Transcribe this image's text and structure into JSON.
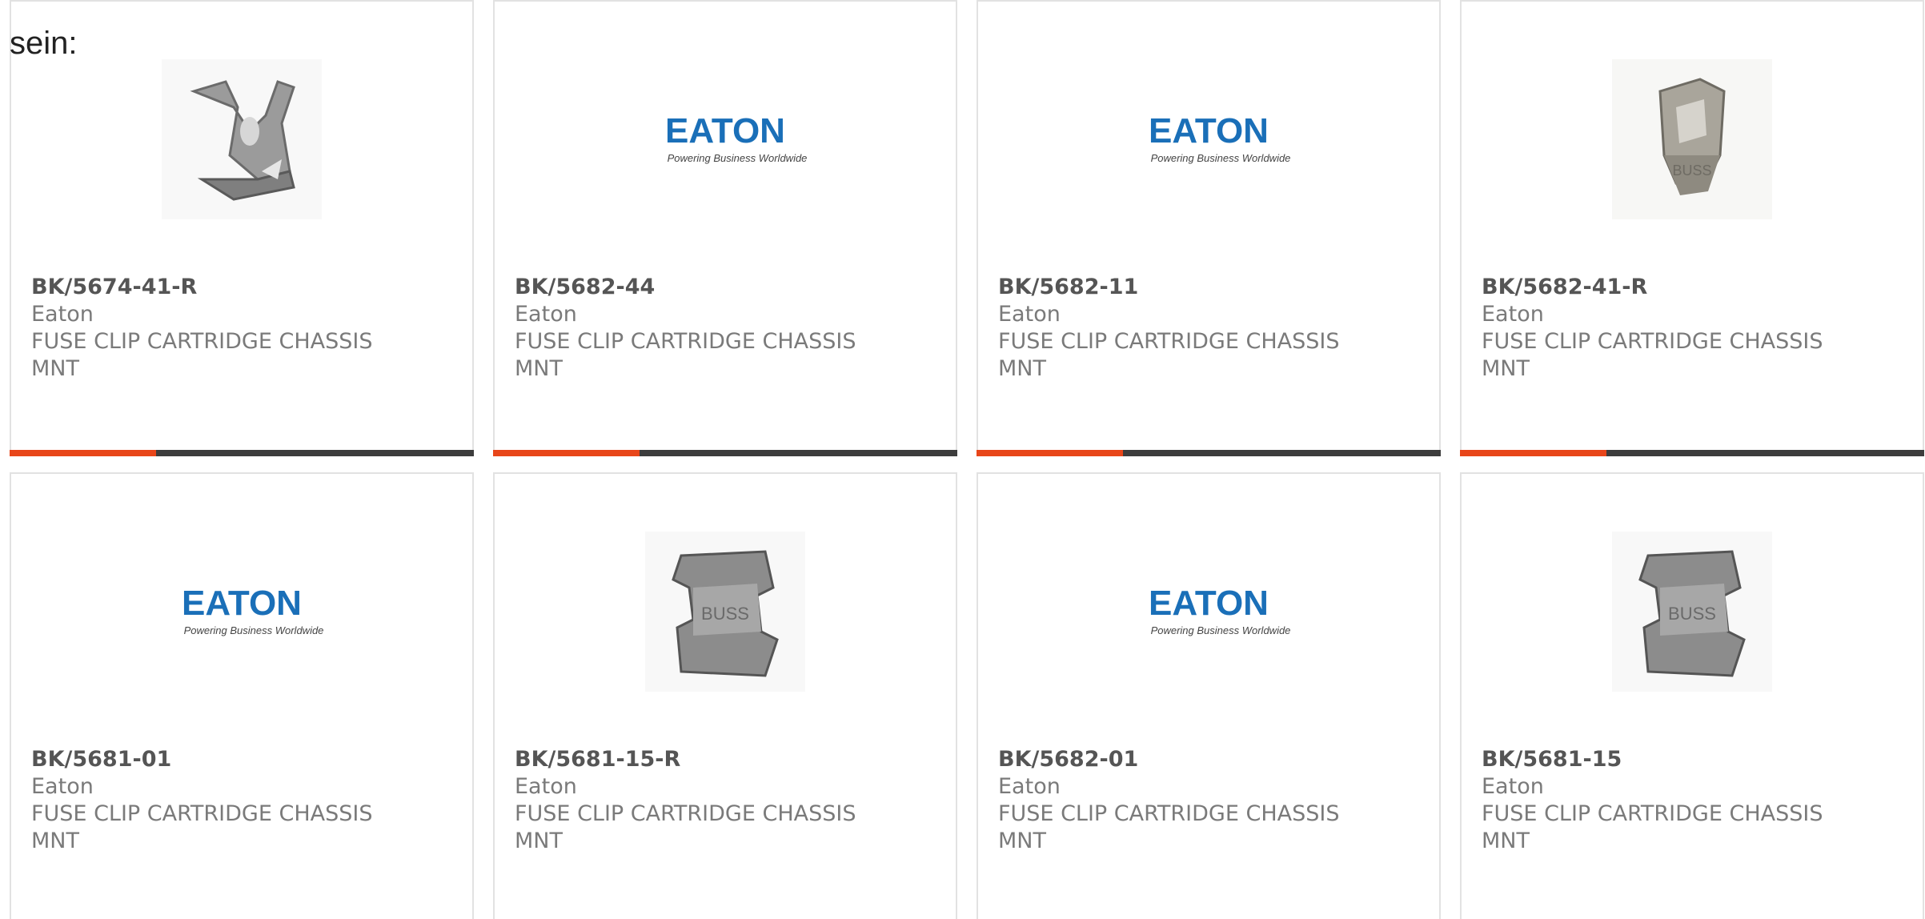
{
  "intro_text": "sein:",
  "colors": {
    "accent": "#e8461a",
    "bar": "#3d3d3d",
    "eaton_blue": "#1a6fb8",
    "border": "#e2e2e2"
  },
  "products": [
    {
      "part": "BK/5674-41-R",
      "maker": "Eaton",
      "desc": "FUSE CLIP CARTRIDGE CHASSIS MNT",
      "image": "fuse-clip-open"
    },
    {
      "part": "BK/5682-44",
      "maker": "Eaton",
      "desc": "FUSE CLIP CARTRIDGE CHASSIS MNT",
      "image": "eaton-logo"
    },
    {
      "part": "BK/5682-11",
      "maker": "Eaton",
      "desc": "FUSE CLIP CARTRIDGE CHASSIS MNT",
      "image": "eaton-logo"
    },
    {
      "part": "BK/5682-41-R",
      "maker": "Eaton",
      "desc": "FUSE CLIP CARTRIDGE CHASSIS MNT",
      "image": "fuse-clip-open"
    },
    {
      "part": "BK/5681-01",
      "maker": "Eaton",
      "desc": "FUSE CLIP CARTRIDGE CHASSIS MNT",
      "image": "eaton-logo"
    },
    {
      "part": "BK/5681-15-R",
      "maker": "Eaton",
      "desc": "FUSE CLIP CARTRIDGE CHASSIS MNT",
      "image": "fuse-clip-block"
    },
    {
      "part": "BK/5682-01",
      "maker": "Eaton",
      "desc": "FUSE CLIP CARTRIDGE CHASSIS MNT",
      "image": "eaton-logo"
    },
    {
      "part": "BK/5681-15",
      "maker": "Eaton",
      "desc": "FUSE CLIP CARTRIDGE CHASSIS MNT",
      "image": "fuse-clip-block"
    }
  ],
  "logo": {
    "wordmark": "EATON",
    "tagline": "Powering Business Worldwide"
  }
}
